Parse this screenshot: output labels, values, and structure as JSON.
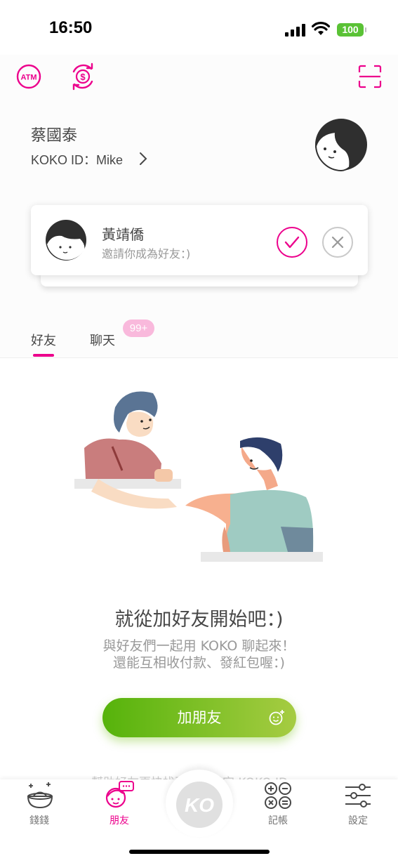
{
  "status_bar": {
    "time": "16:50",
    "battery": "100"
  },
  "header_icons": {
    "atm": "ATM",
    "transfer_icon": "dollar-transfer-icon",
    "scan_icon": "scan-icon"
  },
  "user": {
    "name": "蔡國泰",
    "koko_id": "KOKO ID：Mike"
  },
  "invitation": {
    "name": "黃靖僑",
    "message": "邀請你成為好友：)"
  },
  "tabs": [
    {
      "label": "好友",
      "active": true
    },
    {
      "label": "聊天",
      "badge": "99+"
    }
  ],
  "empty_state": {
    "title": "就從加好友開始吧：)",
    "desc_line1": "與好友們一起用 KOKO 聊起來！",
    "desc_line2": "還能互相收付款、發紅包喔：)",
    "button_label": "加朋友",
    "faint_text": "幫助好友更快找到你？設定 KOKO ID"
  },
  "nav": {
    "items": [
      {
        "label": "錢錢"
      },
      {
        "label": "朋友",
        "active": true
      },
      {
        "label": "KO"
      },
      {
        "label": "記帳"
      },
      {
        "label": "設定"
      }
    ]
  },
  "colors": {
    "accent": "#ec008c",
    "green": "#56b30b",
    "green_light": "#a6cc42",
    "text": "#474747",
    "muted": "#999999"
  }
}
